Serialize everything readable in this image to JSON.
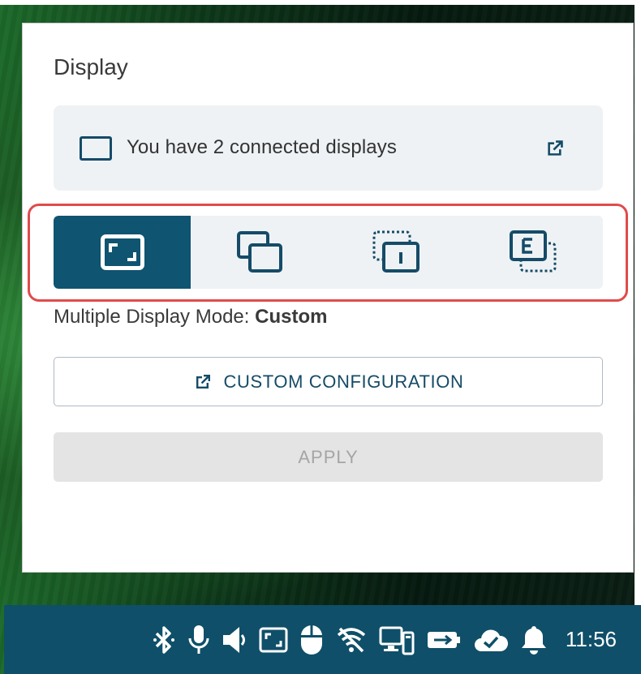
{
  "panel": {
    "title": "Display",
    "info_text": "You have 2 connected displays",
    "modes": [
      {
        "name": "single-display",
        "active": true
      },
      {
        "name": "clone-display",
        "active": false
      },
      {
        "name": "internal-only",
        "active": false
      },
      {
        "name": "external-only",
        "active": false
      }
    ],
    "mode_prefix": "Multiple Display Mode: ",
    "mode_value": "Custom",
    "custom_button_label": "CUSTOM CONFIGURATION",
    "apply_button_label": "APPLY"
  },
  "taskbar": {
    "tray_icons": [
      "bluetooth-icon",
      "microphone-icon",
      "volume-icon",
      "display-icon",
      "mouse-icon",
      "wifi-off-icon",
      "network-display-icon",
      "battery-icon",
      "cloud-check-icon",
      "bell-icon"
    ],
    "clock": "11:56"
  },
  "colors": {
    "accent": "#0f5470",
    "highlight": "#e04b4b",
    "card_bg": "#eef2f5",
    "taskbar_bg": "#0f4f69"
  }
}
